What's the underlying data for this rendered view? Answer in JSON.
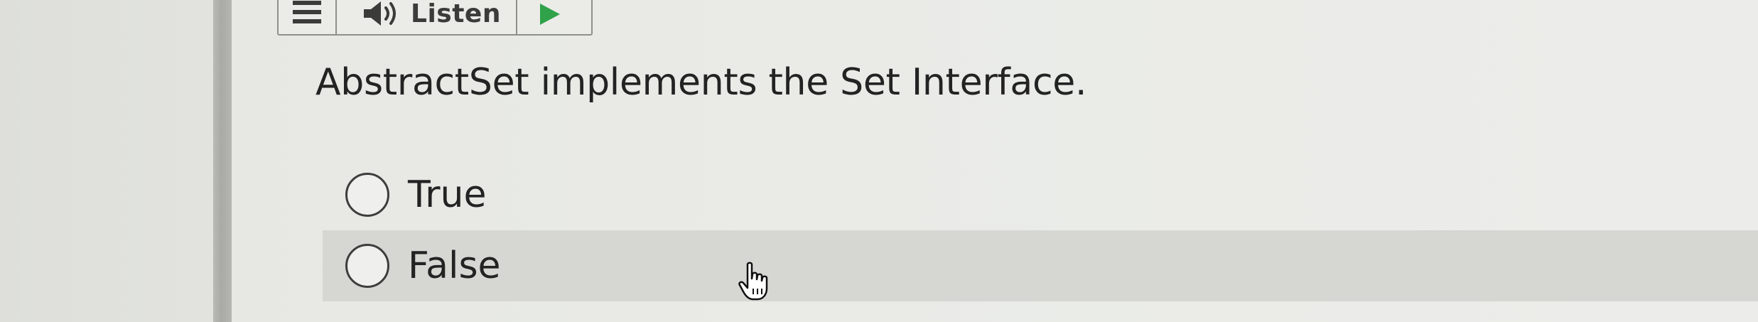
{
  "toolbar": {
    "menu_icon": "menu-icon",
    "listen_icon": "speaker-icon",
    "listen_label": "Listen",
    "play_icon": "play-icon",
    "play_color": "#2fa24a"
  },
  "question": {
    "text": "AbstractSet implements the Set Interface."
  },
  "options": [
    {
      "label": "True",
      "selected": false
    },
    {
      "label": "False",
      "selected": false,
      "hovered": true
    }
  ],
  "cursor": {
    "icon": "hand-pointer-icon"
  }
}
